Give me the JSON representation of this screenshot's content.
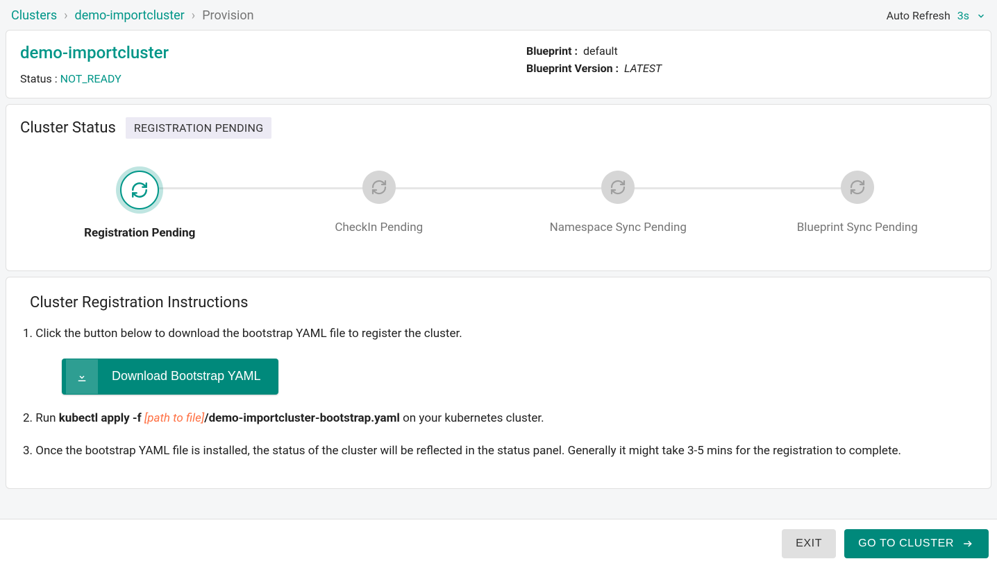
{
  "breadcrumb": {
    "root": "Clusters",
    "cluster": "demo-importcluster",
    "current": "Provision"
  },
  "autorefresh": {
    "label": "Auto Refresh",
    "value": "3s"
  },
  "header": {
    "name": "demo-importcluster",
    "status_label": "Status : ",
    "status_value": "NOT_READY",
    "blueprint_label": "Blueprint :",
    "blueprint_value": "default",
    "version_label": "Blueprint Version :",
    "version_value": "LATEST"
  },
  "status_section": {
    "title": "Cluster Status",
    "badge": "REGISTRATION PENDING",
    "steps": [
      {
        "label": "Registration Pending",
        "active": true
      },
      {
        "label": "CheckIn Pending",
        "active": false
      },
      {
        "label": "Namespace Sync Pending",
        "active": false
      },
      {
        "label": "Blueprint Sync Pending",
        "active": false
      }
    ]
  },
  "instructions": {
    "title": "Cluster Registration Instructions",
    "step1": "1. Click the button below to download the bootstrap YAML file to register the cluster.",
    "download_label": "Download Bootstrap YAML",
    "step2_prefix": "2. Run ",
    "step2_cmd": "kubectl apply -f ",
    "step2_path": "[path to file]",
    "step2_file": "/demo-importcluster-bootstrap.yaml",
    "step2_suffix": " on your kubernetes cluster.",
    "step3": "3. Once the bootstrap YAML file is installed, the status of the cluster will be reflected in the status panel. Generally it might take 3-5 mins for the registration to complete."
  },
  "footer": {
    "exit": "EXIT",
    "go": "GO TO CLUSTER"
  }
}
